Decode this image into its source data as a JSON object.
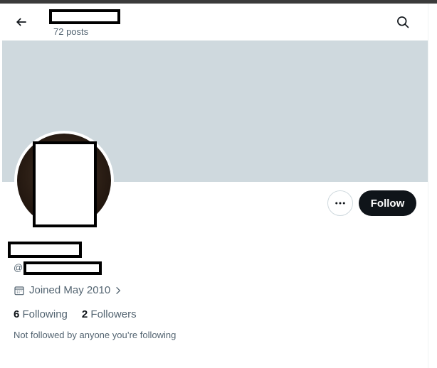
{
  "header": {
    "post_count": "72 posts",
    "back_icon": "arrow-left-icon",
    "search_icon": "search-icon"
  },
  "colors": {
    "banner": "#cfd9de",
    "follow_bg": "#0f1419",
    "secondary_text": "#536471"
  },
  "actions": {
    "follow_label": "Follow",
    "more_icon": "more-horizontal-icon"
  },
  "profile": {
    "handle_prefix": "@",
    "joined": "Joined May 2010",
    "following_count": "6",
    "following_label": "Following",
    "followers_count": "2",
    "followers_label": "Followers",
    "not_followed_text": "Not followed by anyone you’re following"
  }
}
